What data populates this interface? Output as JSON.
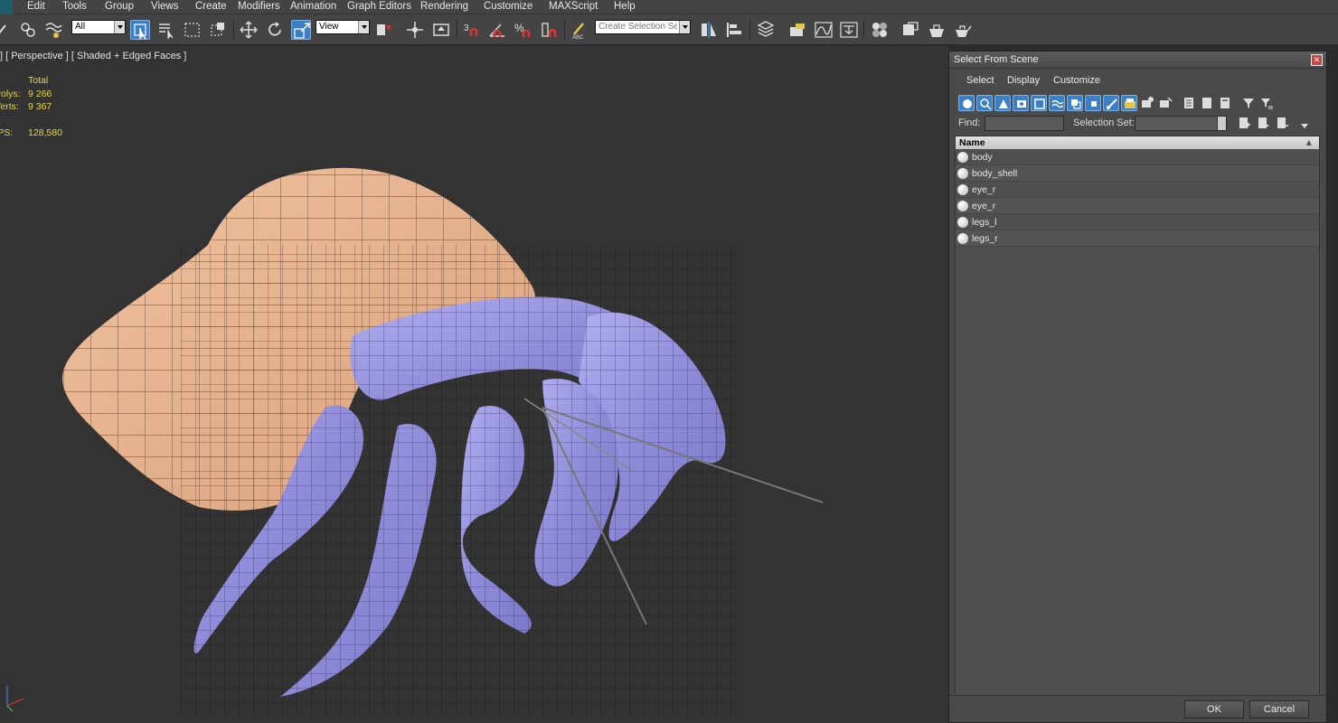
{
  "menu": {
    "items": [
      "Edit",
      "Tools",
      "Group",
      "Views",
      "Create",
      "Modifiers",
      "Animation",
      "Graph Editors",
      "Rendering",
      "Customize",
      "MAXScript",
      "Help"
    ]
  },
  "toolbar": {
    "selection_filter": "All",
    "reference_coord": "View",
    "named_selection_placeholder": "Create Selection Se"
  },
  "viewport": {
    "label": "] [ Perspective ] [ Shaded + Edged Faces ]",
    "stats": {
      "header": "Total",
      "polys_label": "Polys:",
      "polys_value": "9 266",
      "verts_label": "Verts:",
      "verts_value": "9 367",
      "fps_label": "FPS:",
      "fps_value": "128,580"
    }
  },
  "dialog": {
    "title": "Select From Scene",
    "menu": [
      "Select",
      "Display",
      "Customize"
    ],
    "find_label": "Find:",
    "selection_set_label": "Selection Set:",
    "column_header": "Name",
    "objects": [
      "body",
      "body_shell",
      "eye_r",
      "eye_r",
      "legs_l",
      "legs_r"
    ],
    "ok_label": "OK",
    "cancel_label": "Cancel"
  },
  "colors": {
    "ui_bg": "#444444",
    "viewport_bg": "#333333",
    "accent": "#3d7fc4",
    "stats_text": "#e6d84a",
    "shell": "#e3b28f",
    "body": "#9b97e0"
  }
}
